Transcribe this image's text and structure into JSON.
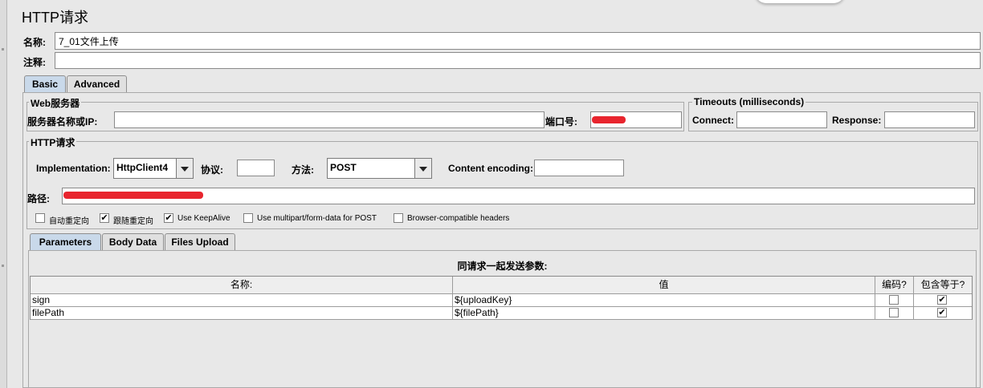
{
  "title": "HTTP请求",
  "name_label": "名称:",
  "name_value": "7_01文件上传",
  "comment_label": "注释:",
  "comment_value": "",
  "main_tabs": [
    {
      "label": "Basic",
      "active": true
    },
    {
      "label": "Advanced",
      "active": false
    }
  ],
  "web_server": {
    "legend": "Web服务器",
    "server_label": "服务器名称或IP:",
    "server_value": "",
    "port_label": "端口号:"
  },
  "timeouts": {
    "legend": "Timeouts (milliseconds)",
    "connect_label": "Connect:",
    "connect_value": "",
    "response_label": "Response:",
    "response_value": ""
  },
  "http_request": {
    "legend": "HTTP请求",
    "implementation_label": "Implementation:",
    "implementation_value": "HttpClient4",
    "protocol_label": "协议:",
    "protocol_value": "",
    "method_label": "方法:",
    "method_value": "POST",
    "encoding_label": "Content encoding:",
    "encoding_value": "",
    "path_label": "路径:"
  },
  "options": [
    {
      "label": "自动重定向",
      "checked": false
    },
    {
      "label": "跟随重定向",
      "checked": true
    },
    {
      "label": "Use KeepAlive",
      "checked": true
    },
    {
      "label": "Use multipart/form-data for POST",
      "checked": false
    },
    {
      "label": "Browser-compatible headers",
      "checked": false
    }
  ],
  "sub_tabs": [
    {
      "label": "Parameters",
      "active": true
    },
    {
      "label": "Body Data",
      "active": false
    },
    {
      "label": "Files Upload",
      "active": false
    }
  ],
  "params": {
    "heading": "同请求一起发送参数:",
    "columns": [
      "名称:",
      "值",
      "编码?",
      "包含等于?"
    ],
    "rows": [
      {
        "name": "sign",
        "value": "${uploadKey}",
        "encode": false,
        "include_equals": true
      },
      {
        "name": "filePath",
        "value": "${filePath}",
        "encode": false,
        "include_equals": true
      }
    ]
  },
  "icons": {
    "dropdown": "chevron-down-icon",
    "check": "checkmark-icon"
  },
  "colors": {
    "active_tab": "#c9d9ea",
    "redaction": "#e8252e"
  }
}
